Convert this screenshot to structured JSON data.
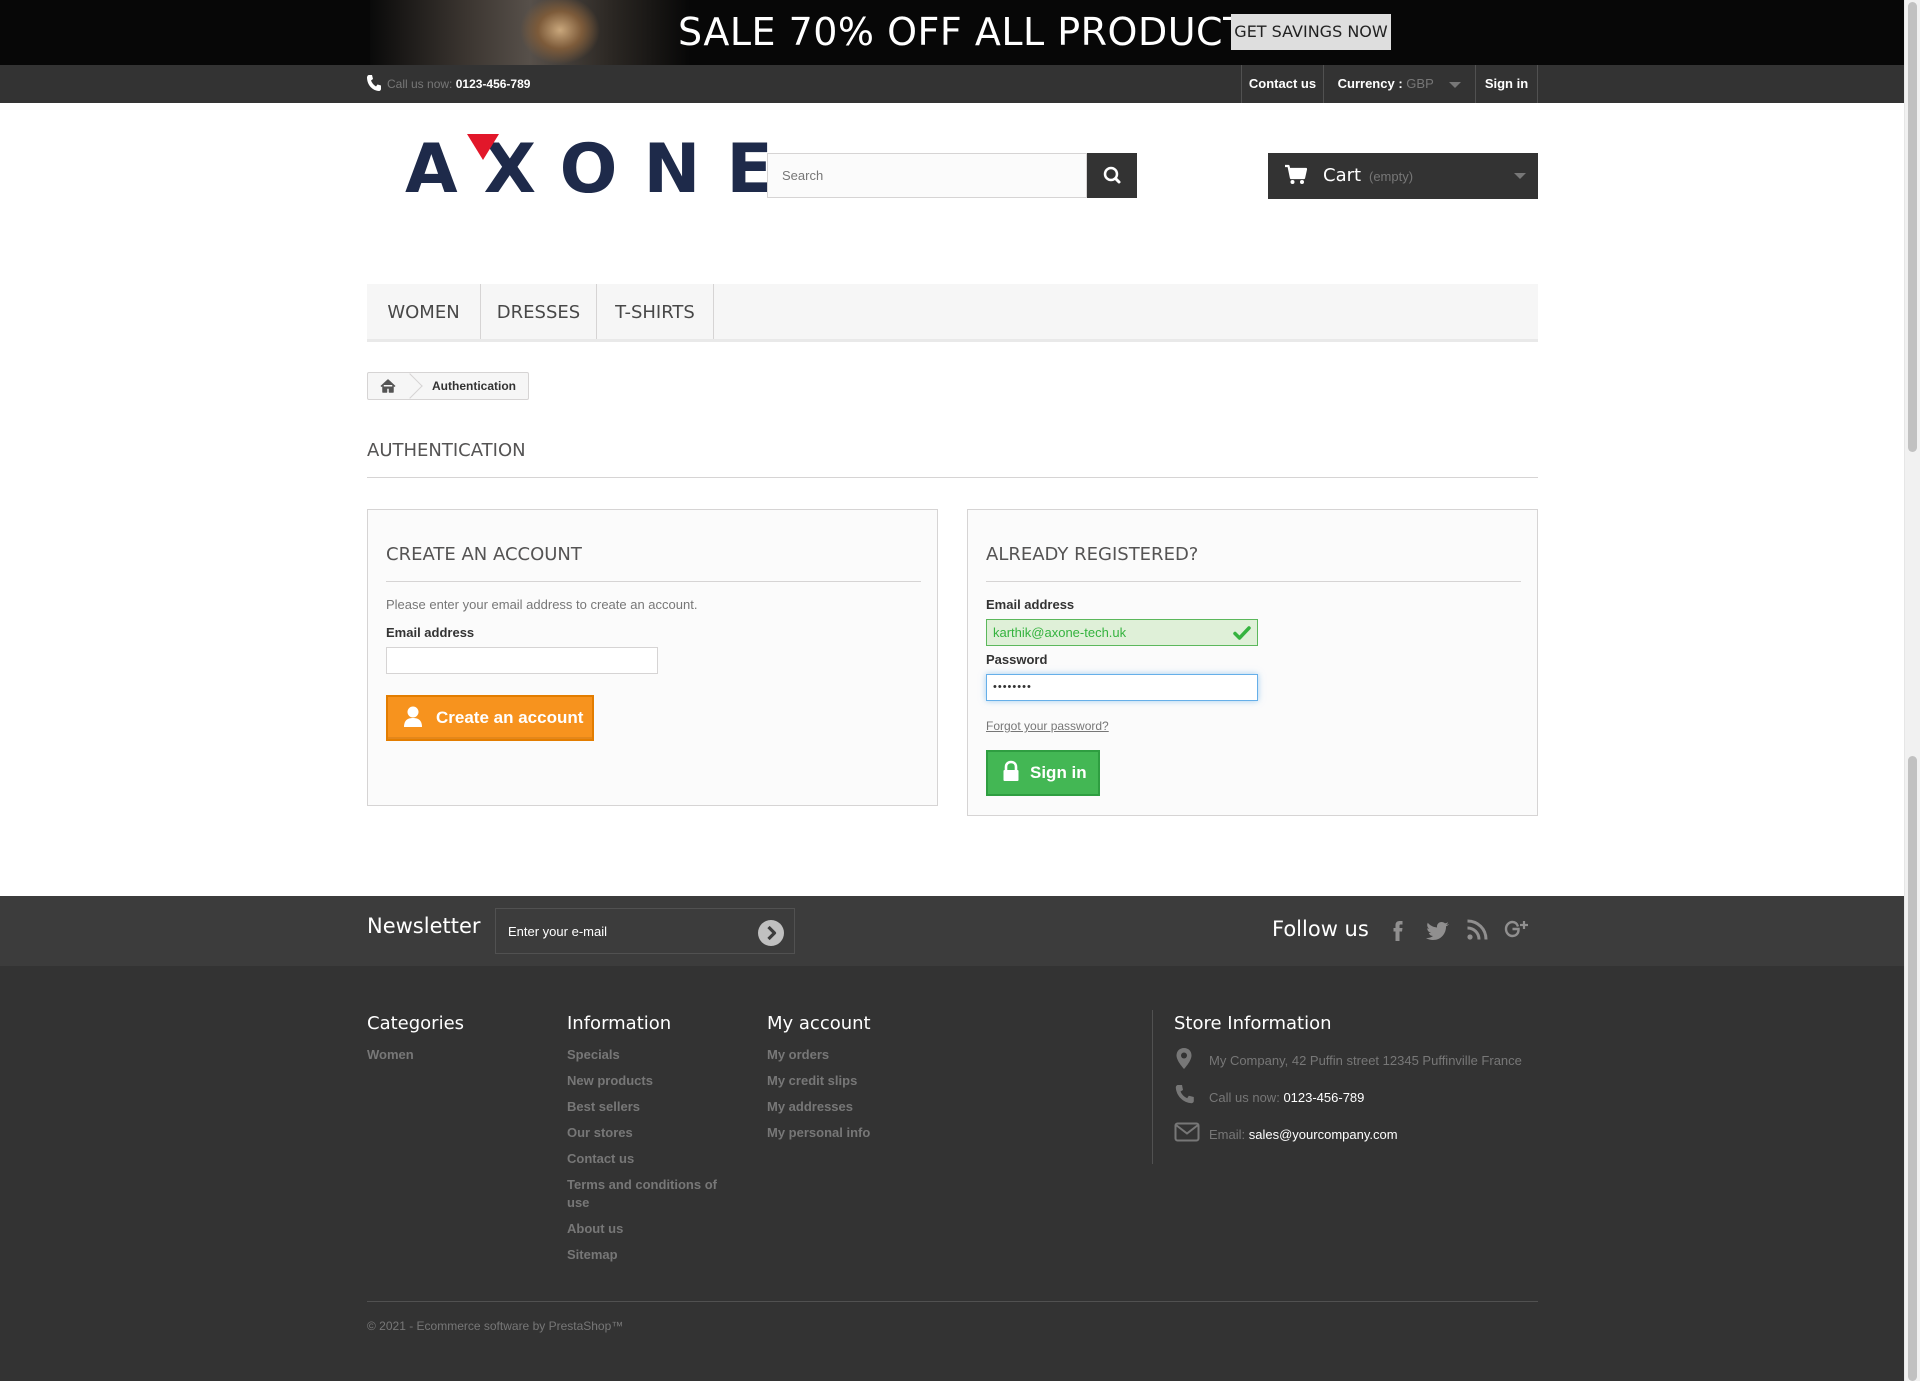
{
  "banner": {
    "text": "SALE 70% OFF ALL PRODUCTS",
    "button_label": "GET SAVINGS NOW"
  },
  "topbar": {
    "call_label": "Call us now:",
    "phone": "0123-456-789",
    "contact_label": "Contact us",
    "currency_label": "Currency :",
    "currency_value": "GBP",
    "signin_label": "Sign in"
  },
  "header": {
    "logo_text": "AXONE",
    "search": {
      "placeholder": "Search"
    },
    "cart": {
      "label": "Cart",
      "state": "(empty)"
    }
  },
  "menu": {
    "items": [
      {
        "label": "WOMEN"
      },
      {
        "label": "DRESSES"
      },
      {
        "label": "T-SHIRTS"
      }
    ]
  },
  "breadcrumb": {
    "current": "Authentication"
  },
  "page": {
    "heading": "AUTHENTICATION"
  },
  "create_account": {
    "title": "CREATE AN ACCOUNT",
    "intro": "Please enter your email address to create an account.",
    "email_label": "Email address",
    "email_value": "",
    "button_label": "Create an account"
  },
  "login": {
    "title": "ALREADY REGISTERED?",
    "email_label": "Email address",
    "email_value": "karthik@axone-tech.uk",
    "password_label": "Password",
    "password_value": "••••••••",
    "forgot_label": "Forgot your password?",
    "button_label": "Sign in"
  },
  "newsletter": {
    "title": "Newsletter",
    "placeholder": "Enter your e-mail",
    "follow_label": "Follow us",
    "social": [
      "facebook-icon",
      "twitter-icon",
      "rss-icon",
      "google-plus-icon"
    ]
  },
  "footer": {
    "categories": {
      "title": "Categories",
      "links": [
        "Women"
      ]
    },
    "information": {
      "title": "Information",
      "links": [
        "Specials",
        "New products",
        "Best sellers",
        "Our stores",
        "Contact us",
        "Terms and conditions of use",
        "About us",
        "Sitemap"
      ]
    },
    "my_account": {
      "title": "My account",
      "links": [
        "My orders",
        "My credit slips",
        "My addresses",
        "My personal info"
      ]
    },
    "store": {
      "title": "Store Information",
      "address": "My Company, 42 Puffin street 12345 Puffinville France",
      "call_label": "Call us now:",
      "phone": "0123-456-789",
      "email_label": "Email:",
      "email": "sales@yourcompany.com"
    },
    "copyright": "© 2021 - Ecommerce software by PrestaShop™"
  },
  "colors": {
    "accent_orange": "#f7931e",
    "accent_green": "#43b754",
    "dark": "#333333",
    "logo_red": "#e2172a",
    "logo_navy": "#1e2a4a"
  }
}
